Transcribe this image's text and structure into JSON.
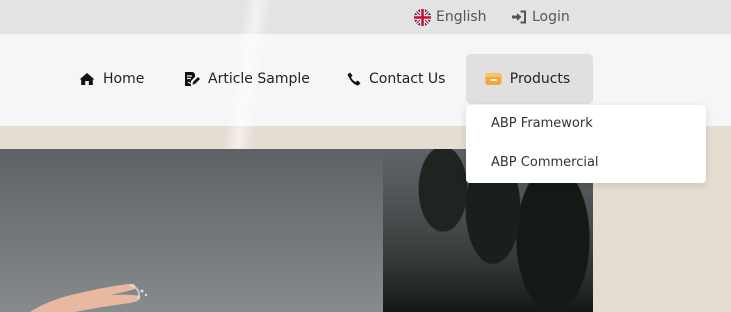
{
  "topbar": {
    "language": {
      "label": "English",
      "icon": "uk-flag-icon"
    },
    "login": {
      "label": "Login",
      "icon": "sign-in-icon"
    }
  },
  "nav": {
    "items": [
      {
        "label": "Home",
        "icon": "home-icon"
      },
      {
        "label": "Article Sample",
        "icon": "edit-document-icon"
      },
      {
        "label": "Contact Us",
        "icon": "phone-icon"
      },
      {
        "label": "Products",
        "icon": "box-icon",
        "active": true
      }
    ]
  },
  "products_menu": {
    "items": [
      {
        "label": "ABP Framework"
      },
      {
        "label": "ABP Commercial"
      }
    ]
  },
  "colors": {
    "topbar_bg": "#e3e3e3",
    "navbar_bg": "#f6f6f6",
    "page_bg": "#e5ddd2",
    "active_nav_bg": "#e0e0e0",
    "products_icon": "#f0a030"
  }
}
